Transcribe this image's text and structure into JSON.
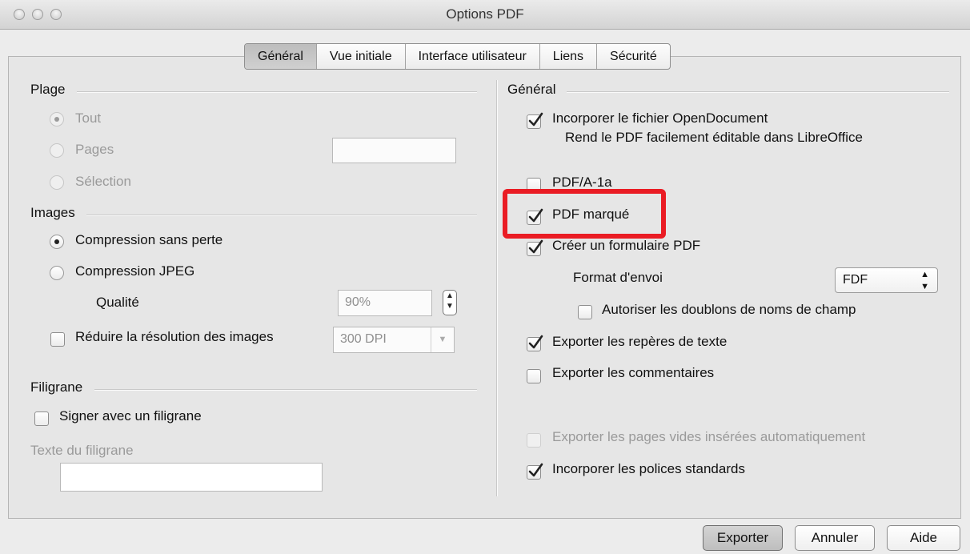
{
  "window": {
    "title": "Options PDF"
  },
  "tabs": [
    "Général",
    "Vue initiale",
    "Interface utilisateur",
    "Liens",
    "Sécurité"
  ],
  "left": {
    "range": {
      "title": "Plage",
      "all": "Tout",
      "pages": "Pages",
      "pages_value": "",
      "selection": "Sélection"
    },
    "images": {
      "title": "Images",
      "lossless": "Compression sans perte",
      "jpeg": "Compression JPEG",
      "quality_label": "Qualité",
      "quality_value": "90%",
      "reduce_res": "Réduire la résolution des images",
      "dpi_value": "300 DPI"
    },
    "watermark": {
      "title": "Filigrane",
      "sign": "Signer avec un filigrane",
      "text_label": "Texte du filigrane",
      "text_value": ""
    }
  },
  "right": {
    "title": "Général",
    "embed_odf": "Incorporer le fichier OpenDocument",
    "embed_odf_hint": "Rend le PDF facilement éditable dans LibreOffice",
    "pdfa": "PDF/A-1a",
    "tagged_pdf": "PDF marqué",
    "create_form": "Créer un formulaire PDF",
    "submit_format_label": "Format d'envoi",
    "submit_format_value": "FDF",
    "allow_duplicates": "Autoriser les doublons de noms de champ",
    "export_bookmarks": "Exporter les repères de texte",
    "export_comments": "Exporter les commentaires",
    "export_blank_pages": "Exporter les pages vides insérées automatiquement",
    "embed_std_fonts": "Incorporer les polices standards"
  },
  "checks": {
    "embed_odf": true,
    "pdfa": false,
    "tagged_pdf": true,
    "create_form": true,
    "allow_duplicates": false,
    "export_bookmarks": true,
    "export_comments": false,
    "export_blank_pages": false,
    "embed_std_fonts": true,
    "reduce_res": false,
    "sign": false
  },
  "buttons": {
    "export": "Exporter",
    "cancel": "Annuler",
    "help": "Aide"
  },
  "colors": {
    "highlight": "#ea1c24"
  }
}
